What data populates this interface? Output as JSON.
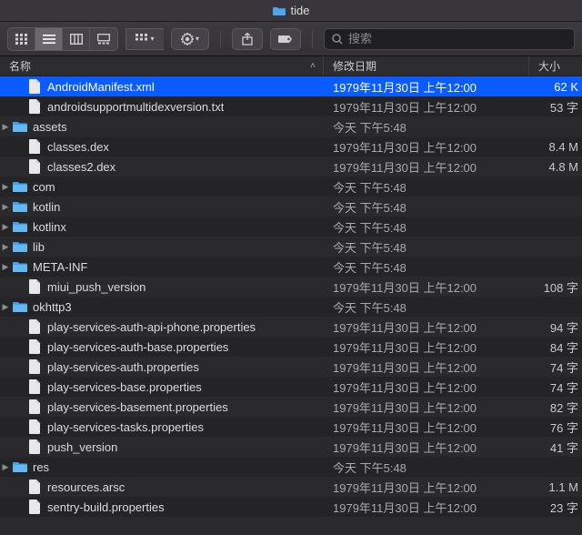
{
  "window": {
    "title": "tide"
  },
  "search": {
    "placeholder": "搜索"
  },
  "columns": {
    "name": "名称",
    "modified": "修改日期",
    "size": "大小"
  },
  "date_old": "1979年11月30日 上午12:00",
  "date_today": "今天 下午5:48",
  "rows": [
    {
      "kind": "file",
      "indent": 1,
      "name": "AndroidManifest.xml",
      "date": "old",
      "size": "62 K",
      "selected": true
    },
    {
      "kind": "file",
      "indent": 1,
      "name": "androidsupportmultidexversion.txt",
      "date": "old",
      "size": "53 字"
    },
    {
      "kind": "folder",
      "indent": 0,
      "name": "assets",
      "date": "today",
      "size": ""
    },
    {
      "kind": "file",
      "indent": 1,
      "name": "classes.dex",
      "date": "old",
      "size": "8.4 M"
    },
    {
      "kind": "file",
      "indent": 1,
      "name": "classes2.dex",
      "date": "old",
      "size": "4.8 M"
    },
    {
      "kind": "folder",
      "indent": 0,
      "name": "com",
      "date": "today",
      "size": ""
    },
    {
      "kind": "folder",
      "indent": 0,
      "name": "kotlin",
      "date": "today",
      "size": ""
    },
    {
      "kind": "folder",
      "indent": 0,
      "name": "kotlinx",
      "date": "today",
      "size": ""
    },
    {
      "kind": "folder",
      "indent": 0,
      "name": "lib",
      "date": "today",
      "size": ""
    },
    {
      "kind": "folder",
      "indent": 0,
      "name": "META-INF",
      "date": "today",
      "size": ""
    },
    {
      "kind": "file",
      "indent": 1,
      "name": "miui_push_version",
      "date": "old",
      "size": "108 字"
    },
    {
      "kind": "folder",
      "indent": 0,
      "name": "okhttp3",
      "date": "today",
      "size": ""
    },
    {
      "kind": "file",
      "indent": 1,
      "name": "play-services-auth-api-phone.properties",
      "date": "old",
      "size": "94 字"
    },
    {
      "kind": "file",
      "indent": 1,
      "name": "play-services-auth-base.properties",
      "date": "old",
      "size": "84 字"
    },
    {
      "kind": "file",
      "indent": 1,
      "name": "play-services-auth.properties",
      "date": "old",
      "size": "74 字"
    },
    {
      "kind": "file",
      "indent": 1,
      "name": "play-services-base.properties",
      "date": "old",
      "size": "74 字"
    },
    {
      "kind": "file",
      "indent": 1,
      "name": "play-services-basement.properties",
      "date": "old",
      "size": "82 字"
    },
    {
      "kind": "file",
      "indent": 1,
      "name": "play-services-tasks.properties",
      "date": "old",
      "size": "76 字"
    },
    {
      "kind": "file",
      "indent": 1,
      "name": "push_version",
      "date": "old",
      "size": "41 字"
    },
    {
      "kind": "folder",
      "indent": 0,
      "name": "res",
      "date": "today",
      "size": ""
    },
    {
      "kind": "file",
      "indent": 1,
      "name": "resources.arsc",
      "date": "old",
      "size": "1.1 M"
    },
    {
      "kind": "file",
      "indent": 1,
      "name": "sentry-build.properties",
      "date": "old",
      "size": "23 字"
    }
  ]
}
